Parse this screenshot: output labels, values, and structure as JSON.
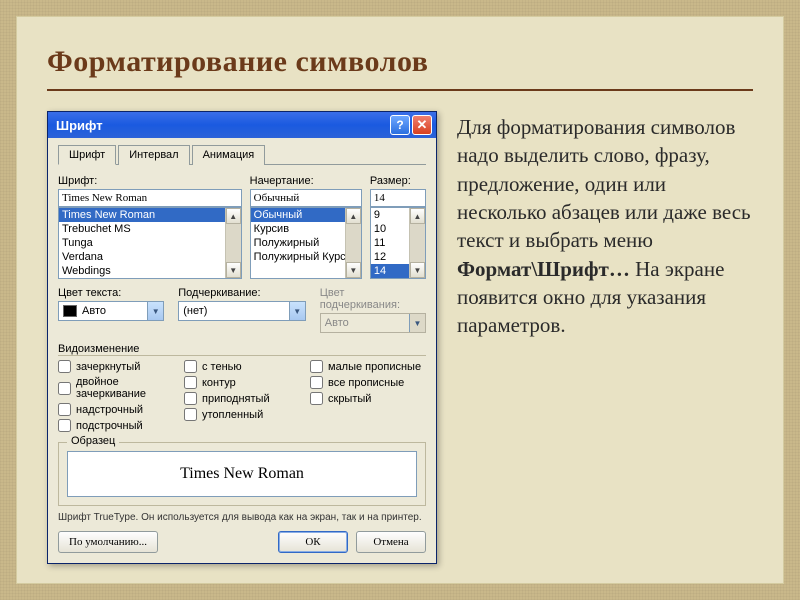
{
  "slide": {
    "title": "Форматирование символов",
    "paragraph_before": "Для форматирования символов надо выделить слово, фразу, предложение, один или несколько абзацев или даже весь текст и выбрать меню ",
    "bold_menu": "Формат\\Шрифт…",
    "paragraph_after": " На экране появится окно для указания параметров."
  },
  "dialog": {
    "title": "Шрифт",
    "help": "?",
    "close": "✕",
    "tabs": [
      "Шрифт",
      "Интервал",
      "Анимация"
    ],
    "labels": {
      "font": "Шрифт:",
      "style": "Начертание:",
      "size": "Размер:",
      "color": "Цвет текста:",
      "underline": "Подчеркивание:",
      "underline_color": "Цвет подчеркивания:",
      "effects": "Видоизменение",
      "sample": "Образец"
    },
    "font": {
      "value": "Times New Roman",
      "items": [
        "Times New Roman",
        "Trebuchet MS",
        "Tunga",
        "Verdana",
        "Webdings"
      ],
      "selected_index": 0
    },
    "style": {
      "value": "Обычный",
      "items": [
        "Обычный",
        "Курсив",
        "Полужирный",
        "Полужирный Курсив"
      ],
      "selected_index": 0
    },
    "size": {
      "value": "14",
      "items": [
        "9",
        "10",
        "11",
        "12",
        "14"
      ],
      "selected_index": 4
    },
    "color": {
      "value": "Авто"
    },
    "underline": {
      "value": "(нет)"
    },
    "underline_color": {
      "value": "Авто"
    },
    "effects": {
      "col1": [
        "зачеркнутый",
        "двойное зачеркивание",
        "надстрочный",
        "подстрочный"
      ],
      "col2": [
        "с тенью",
        "контур",
        "приподнятый",
        "утопленный"
      ],
      "col3": [
        "малые прописные",
        "все прописные",
        "скрытый"
      ]
    },
    "preview": "Times New Roman",
    "hint": "Шрифт TrueType. Он используется для вывода как на экран, так и на принтер.",
    "buttons": {
      "default": "По умолчанию...",
      "ok": "ОК",
      "cancel": "Отмена"
    }
  }
}
